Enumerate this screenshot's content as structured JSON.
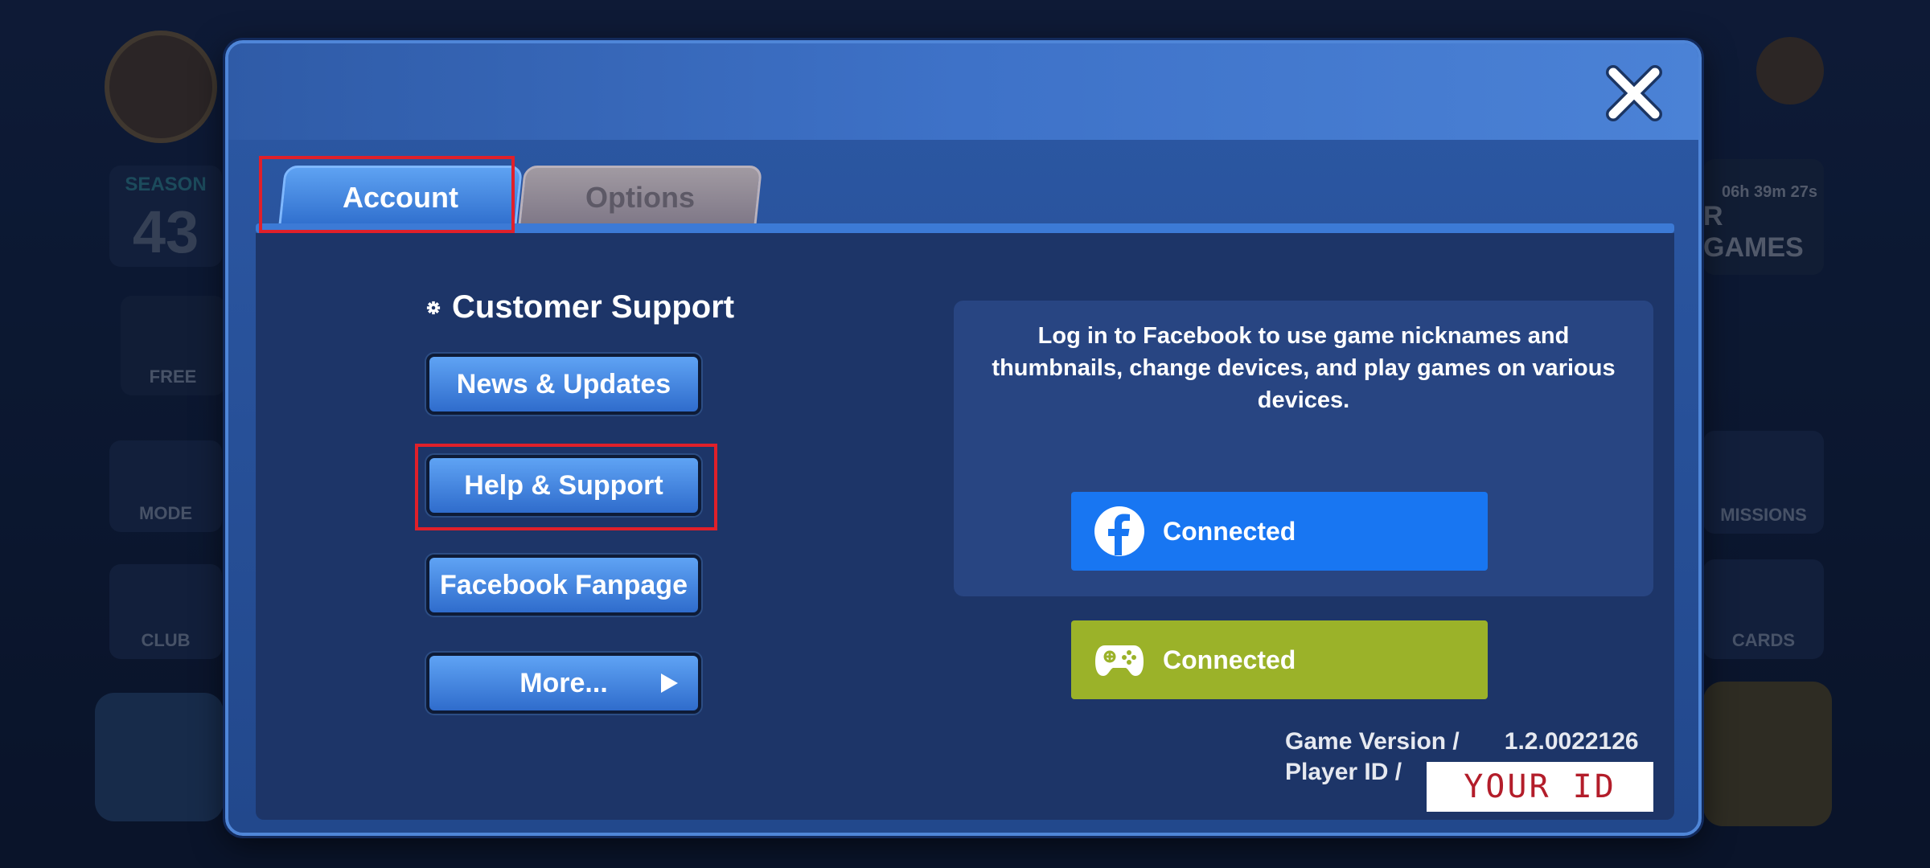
{
  "background": {
    "season_label": "SEASON",
    "season_number": "43",
    "free_label": "FREE",
    "mode_label": "MODE",
    "club_label": "CLUB",
    "timer": "06h 39m 27s",
    "games_label": "R GAMES",
    "missions_label": "MISSIONS",
    "cards_label": "CARDS"
  },
  "tabs": [
    {
      "label": "Account",
      "active": true
    },
    {
      "label": "Options",
      "active": false
    }
  ],
  "customer_support": {
    "title": "Customer Support",
    "buttons": {
      "news": "News & Updates",
      "help": "Help & Support",
      "fanpage": "Facebook Fanpage",
      "more": "More..."
    }
  },
  "facebook_panel": {
    "description": "Log in to Facebook to use game nicknames and thumbnails, change devices, and play games on various devices."
  },
  "connections": {
    "facebook_status": "Connected",
    "gameplay_status": "Connected"
  },
  "info": {
    "version_label": "Game Version /",
    "version_value": "1.2.0022126",
    "player_id_label": "Player ID /",
    "player_id_value": "YOUR ID"
  },
  "colors": {
    "facebook_blue": "#1876f2",
    "games_green": "#9bb229",
    "highlight_red": "#e0202a"
  }
}
